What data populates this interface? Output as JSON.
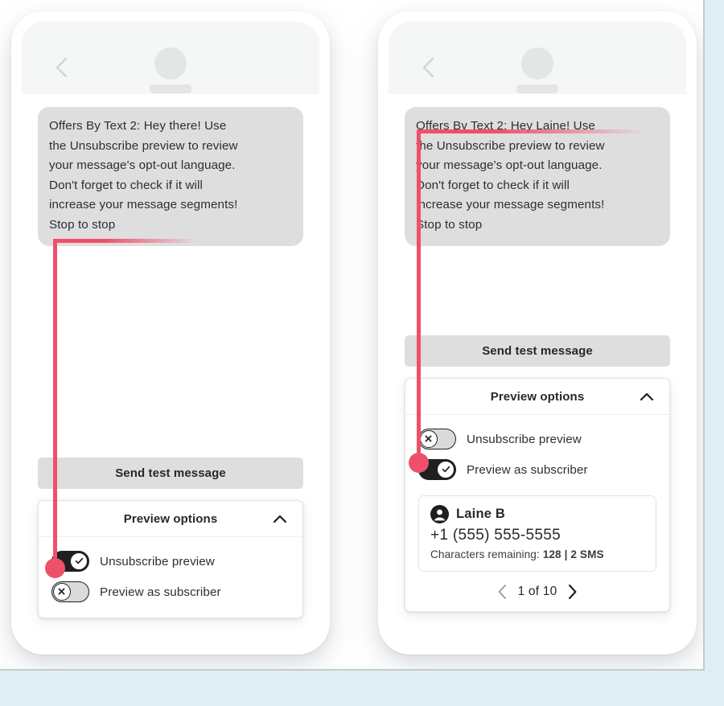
{
  "theme": {
    "accent_red": "#ef5069",
    "page_background": "#dfedf4",
    "bubble_gray": "#dededf",
    "button_gray": "#dededf",
    "toggle_on": "#1d1f21",
    "toggle_off": "#d9dadb"
  },
  "phones": [
    {
      "id": "left",
      "header": {
        "back_icon": "chevron-left-icon",
        "avatar_icon": "avatar-placeholder-icon"
      },
      "message": {
        "lines": [
          "Offers By Text 2: Hey there! Use",
          "the Unsubscribe preview to review",
          "your message's opt-out language.",
          "Don't forget to check if it will",
          "increase your message segments!",
          "Stop to stop"
        ]
      },
      "send_test_label": "Send test message",
      "panel": {
        "title": "Preview options",
        "collapse_icon": "chevron-up-icon",
        "toggles": [
          {
            "label": "Unsubscribe preview",
            "state": "on",
            "icon": "check-icon"
          },
          {
            "label": "Preview as subscriber",
            "state": "off",
            "icon": "close-x-icon"
          }
        ]
      },
      "annotation": {
        "target": "Stop to stop",
        "anchor": "unsubscribe-preview-toggle"
      }
    },
    {
      "id": "right",
      "header": {
        "back_icon": "chevron-left-icon",
        "avatar_icon": "avatar-placeholder-icon"
      },
      "message": {
        "lines": [
          "Offers By Text 2: Hey Laine! Use",
          "the Unsubscribe preview to review",
          "your message's opt-out language.",
          "Don't forget to check if it will",
          "increase your message segments!",
          "Stop to stop"
        ]
      },
      "send_test_label": "Send test message",
      "panel": {
        "title": "Preview options",
        "collapse_icon": "chevron-up-icon",
        "toggles": [
          {
            "label": "Unsubscribe preview",
            "state": "off",
            "icon": "close-x-icon"
          },
          {
            "label": "Preview as subscriber",
            "state": "on",
            "icon": "check-icon"
          }
        ]
      },
      "subscriber_card": {
        "avatar_icon": "person-icon",
        "name": "Laine B",
        "phone": "+1 (555) 555-5555",
        "characters_label": "Characters remaining:",
        "characters_remaining": "128",
        "separator": "|",
        "sms_count": "2 SMS"
      },
      "pager": {
        "prev_icon": "chevron-left-icon",
        "next_icon": "chevron-right-icon",
        "position_text": "1 of 10",
        "current_page": 1,
        "total_pages": 10
      },
      "annotation": {
        "target": "Offers By Text 2: Hey Laine! Use",
        "anchor": "preview-as-subscriber-toggle"
      }
    }
  ]
}
